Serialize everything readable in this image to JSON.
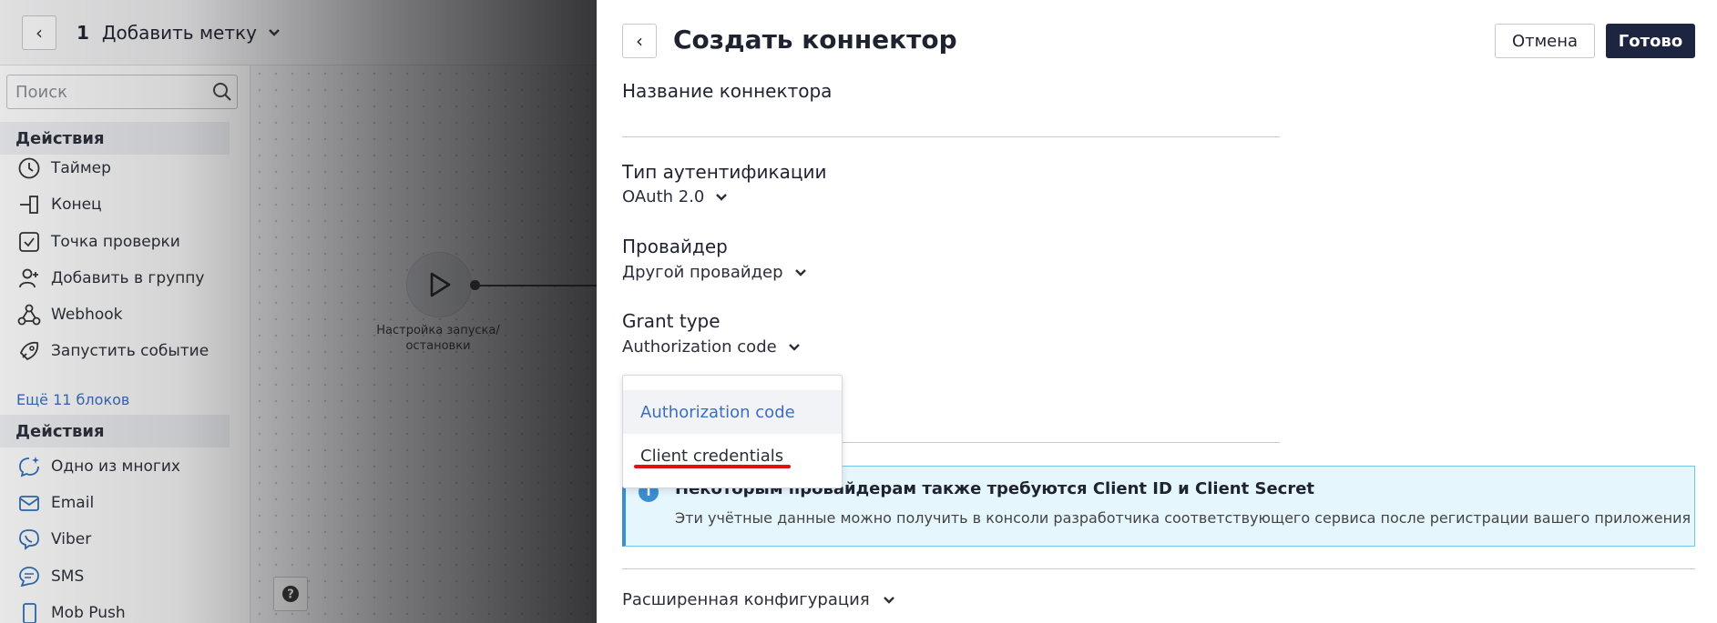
{
  "editor": {
    "step_number": "1",
    "step_label": "Добавить метку",
    "search_placeholder": "Поиск",
    "section1_title": "Действия",
    "section1_items": [
      "Таймер",
      "Конец",
      "Точка проверки",
      "Добавить в группу",
      "Webhook",
      "Запустить событие"
    ],
    "more_link": "Ещё 11 блоков",
    "section2_title": "Действия",
    "section2_items": [
      "Одно из многих",
      "Email",
      "Viber",
      "SMS",
      "Mob Push"
    ],
    "start_node_label": "Настройка запуска/остановки"
  },
  "panel": {
    "title": "Создать коннектор",
    "cancel_label": "Отмена",
    "done_label": "Готово",
    "name_label": "Название коннектора",
    "auth_label": "Тип аутентификации",
    "auth_value": "OAuth 2.0",
    "provider_label": "Провайдер",
    "provider_value": "Другой провайдер",
    "grant_label": "Grant type",
    "grant_value": "Authorization code",
    "grant_options": [
      "Authorization code",
      "Client credentials"
    ],
    "info_title": "Некоторым провайдерам также требуются Client ID и Client Secret",
    "info_text": "Эти учётные данные можно получить в консоли разработчика соответствующего сервиса после регистрации вашего приложения",
    "advanced_label": "Расширенная конфигурация"
  },
  "colors": {
    "accent_blue": "#3b6dc4",
    "primary_button": "#1e2540",
    "info_bg": "#e6f6fd",
    "annotation_red": "#e01010"
  }
}
